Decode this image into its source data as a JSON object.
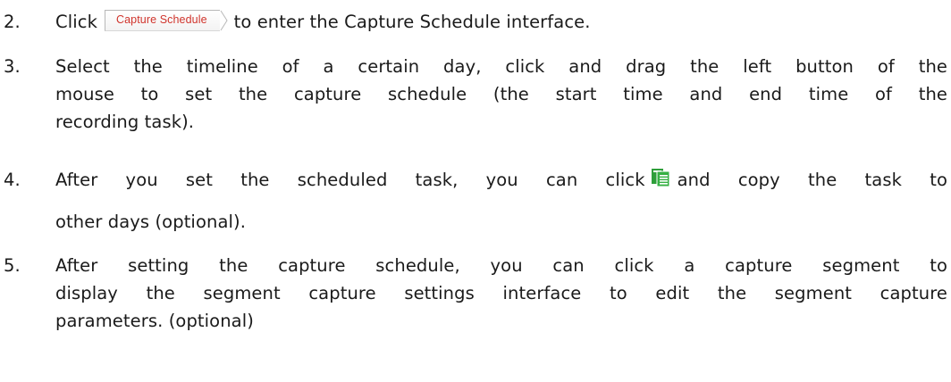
{
  "steps": [
    {
      "number": "2.",
      "text_before": "Click",
      "button_label": "Capture Schedule",
      "text_after": "to enter the Capture Schedule interface."
    },
    {
      "number": "3.",
      "lines": [
        "Select the timeline of a certain day, click and drag the left button of the",
        "mouse to set the capture schedule (the start time and end time of the",
        "recording task)."
      ]
    },
    {
      "number": "4.",
      "text_before": "After you set the scheduled task, you can click",
      "icon": "copy-icon",
      "text_after": "and copy the task to",
      "line2": "other days (optional)."
    },
    {
      "number": "5.",
      "lines": [
        "After setting the capture schedule, you can click a capture segment to",
        "display the segment capture settings interface to edit the segment capture",
        "parameters. (optional)"
      ]
    }
  ],
  "colors": {
    "button_text": "#d0342c",
    "icon_green": "#2e9e3a"
  }
}
